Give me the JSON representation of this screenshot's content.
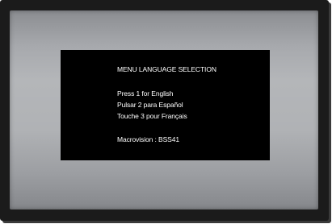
{
  "menu": {
    "title": "MENU LANGUAGE SELECTION",
    "options": [
      "Press 1 for English",
      "Pulsar 2 para Español",
      "Touche 3 pour Français"
    ],
    "macrovision": "Macrovision : BSS41"
  },
  "colors": {
    "frame": "#1b1b1b",
    "screen_gray": "#b0b2b5",
    "osd_background": "#000000",
    "osd_text": "#ffffff"
  }
}
